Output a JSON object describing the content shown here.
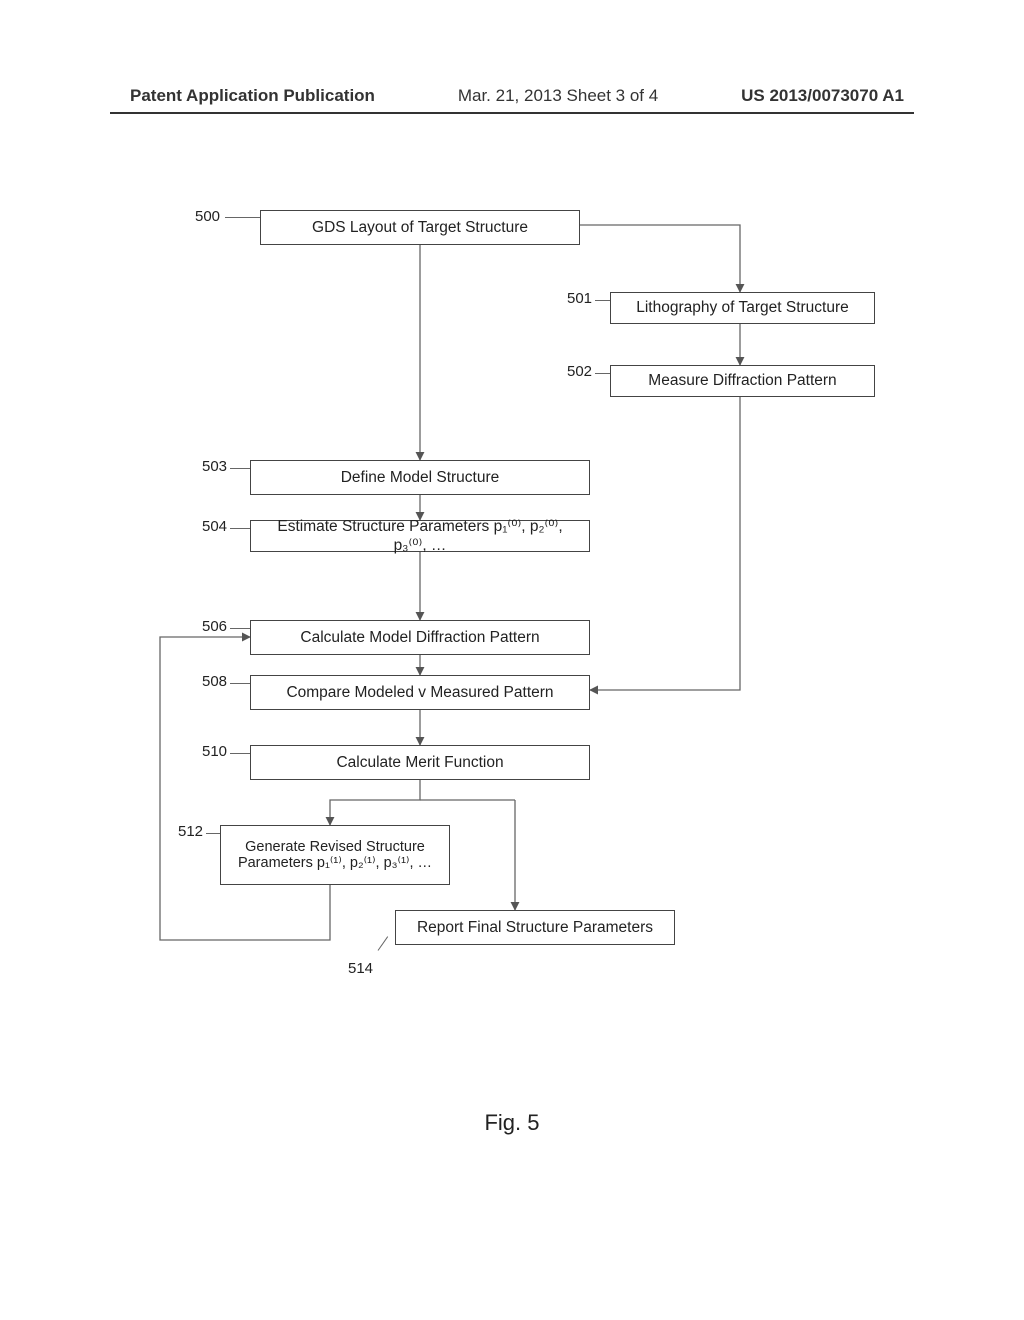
{
  "header": {
    "left": "Patent Application Publication",
    "mid": "Mar. 21, 2013  Sheet 3 of 4",
    "right": "US 2013/0073070 A1"
  },
  "boxes": {
    "b500": "GDS Layout of Target Structure",
    "b501": "Lithography of Target Structure",
    "b502": "Measure Diffraction Pattern",
    "b503": "Define Model Structure",
    "b504": "Estimate Structure Parameters p₁⁽⁰⁾, p₂⁽⁰⁾, p₃⁽⁰⁾, …",
    "b506": "Calculate Model Diffraction Pattern",
    "b508": "Compare Modeled v Measured Pattern",
    "b510": "Calculate Merit Function",
    "b512": "Generate Revised Structure Parameters p₁⁽¹⁾, p₂⁽¹⁾, p₃⁽¹⁾, …",
    "b514": "Report Final Structure Parameters"
  },
  "labels": {
    "l500": "500",
    "l501": "501",
    "l502": "502",
    "l503": "503",
    "l504": "504",
    "l506": "506",
    "l508": "508",
    "l510": "510",
    "l512": "512",
    "l514": "514"
  },
  "caption": "Fig. 5"
}
